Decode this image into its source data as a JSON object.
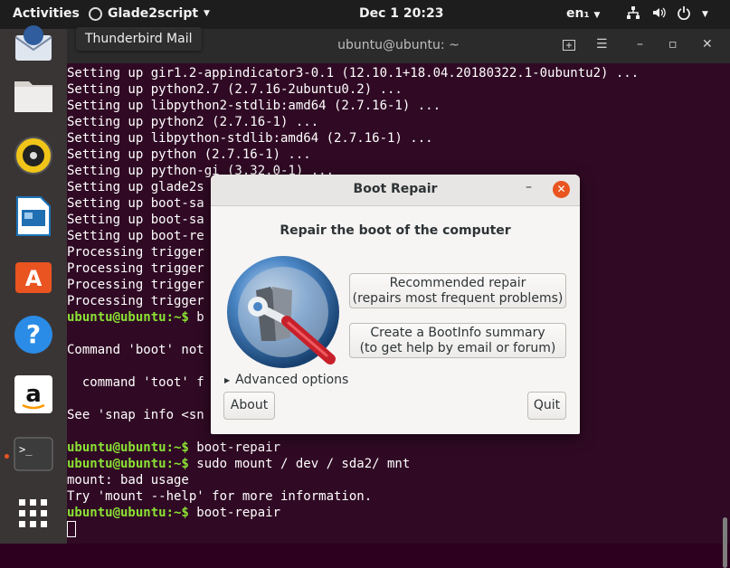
{
  "topbar": {
    "activities": "Activities",
    "app_menu": "Glade2script",
    "clock": "Dec 1  20:23",
    "language": "en₁",
    "tray_icons": [
      "network-icon",
      "volume-icon",
      "power-icon"
    ]
  },
  "tooltip": "Thunderbird Mail",
  "dock": {
    "items": [
      "thunderbird-icon",
      "files-icon",
      "rhythmbox-icon",
      "libreoffice-writer-icon",
      "ubuntu-software-icon",
      "help-icon",
      "amazon-icon",
      "terminal-icon",
      "show-applications-icon"
    ]
  },
  "terminal": {
    "title": "ubuntu@ubuntu: ~",
    "lines": [
      {
        "prompt": "",
        "text": "Setting up gir1.2-appindicator3-0.1 (12.10.1+18.04.20180322.1-0ubuntu2) ..."
      },
      {
        "prompt": "",
        "text": "Setting up python2.7 (2.7.16-2ubuntu0.2) ..."
      },
      {
        "prompt": "",
        "text": "Setting up libpython2-stdlib:amd64 (2.7.16-1) ..."
      },
      {
        "prompt": "",
        "text": "Setting up python2 (2.7.16-1) ..."
      },
      {
        "prompt": "",
        "text": "Setting up libpython-stdlib:amd64 (2.7.16-1) ..."
      },
      {
        "prompt": "",
        "text": "Setting up python (2.7.16-1) ..."
      },
      {
        "prompt": "",
        "text": "Setting up python-gi (3.32.0-1) ..."
      },
      {
        "prompt": "",
        "text": "Setting up glade2s"
      },
      {
        "prompt": "",
        "text": "Setting up boot-sa"
      },
      {
        "prompt": "",
        "text": "Setting up boot-sa"
      },
      {
        "prompt": "",
        "text": "Setting up boot-re"
      },
      {
        "prompt": "",
        "text": "Processing trigger"
      },
      {
        "prompt": "",
        "text": "Processing trigger"
      },
      {
        "prompt": "",
        "text": "Processing trigger"
      },
      {
        "prompt": "",
        "text": "Processing trigger"
      },
      {
        "prompt": "ubuntu@ubuntu:~$",
        "text": " b"
      },
      {
        "prompt": "",
        "text": ""
      },
      {
        "prompt": "",
        "text": "Command 'boot' not"
      },
      {
        "prompt": "",
        "text": ""
      },
      {
        "prompt": "",
        "text": "  command 'toot' f"
      },
      {
        "prompt": "",
        "text": ""
      },
      {
        "prompt": "",
        "text": "See 'snap info <sn"
      },
      {
        "prompt": "",
        "text": ""
      },
      {
        "prompt": "ubuntu@ubuntu:~$",
        "text": " boot-repair"
      },
      {
        "prompt": "ubuntu@ubuntu:~$",
        "text": " sudo mount / dev / sda2/ mnt"
      },
      {
        "prompt": "",
        "text": "mount: bad usage"
      },
      {
        "prompt": "",
        "text": "Try 'mount --help' for more information."
      },
      {
        "prompt": "ubuntu@ubuntu:~$",
        "text": " boot-repair"
      }
    ]
  },
  "dialog": {
    "title": "Boot Repair",
    "heading": "Repair the boot of the computer",
    "recommended_line1": "Recommended repair",
    "recommended_line2": "(repairs most frequent problems)",
    "bootinfo_line1": "Create a BootInfo summary",
    "bootinfo_line2": "(to get help by email or forum)",
    "advanced": "Advanced options",
    "about": "About",
    "quit": "Quit",
    "close_glyph": "✕",
    "minimize_glyph": "–"
  },
  "colors": {
    "terminal_bg": "#300a24",
    "prompt": "#8ae234",
    "accent": "#e95420",
    "dock_bg": "#3a3535",
    "topbar_bg": "#1d1d1d"
  }
}
